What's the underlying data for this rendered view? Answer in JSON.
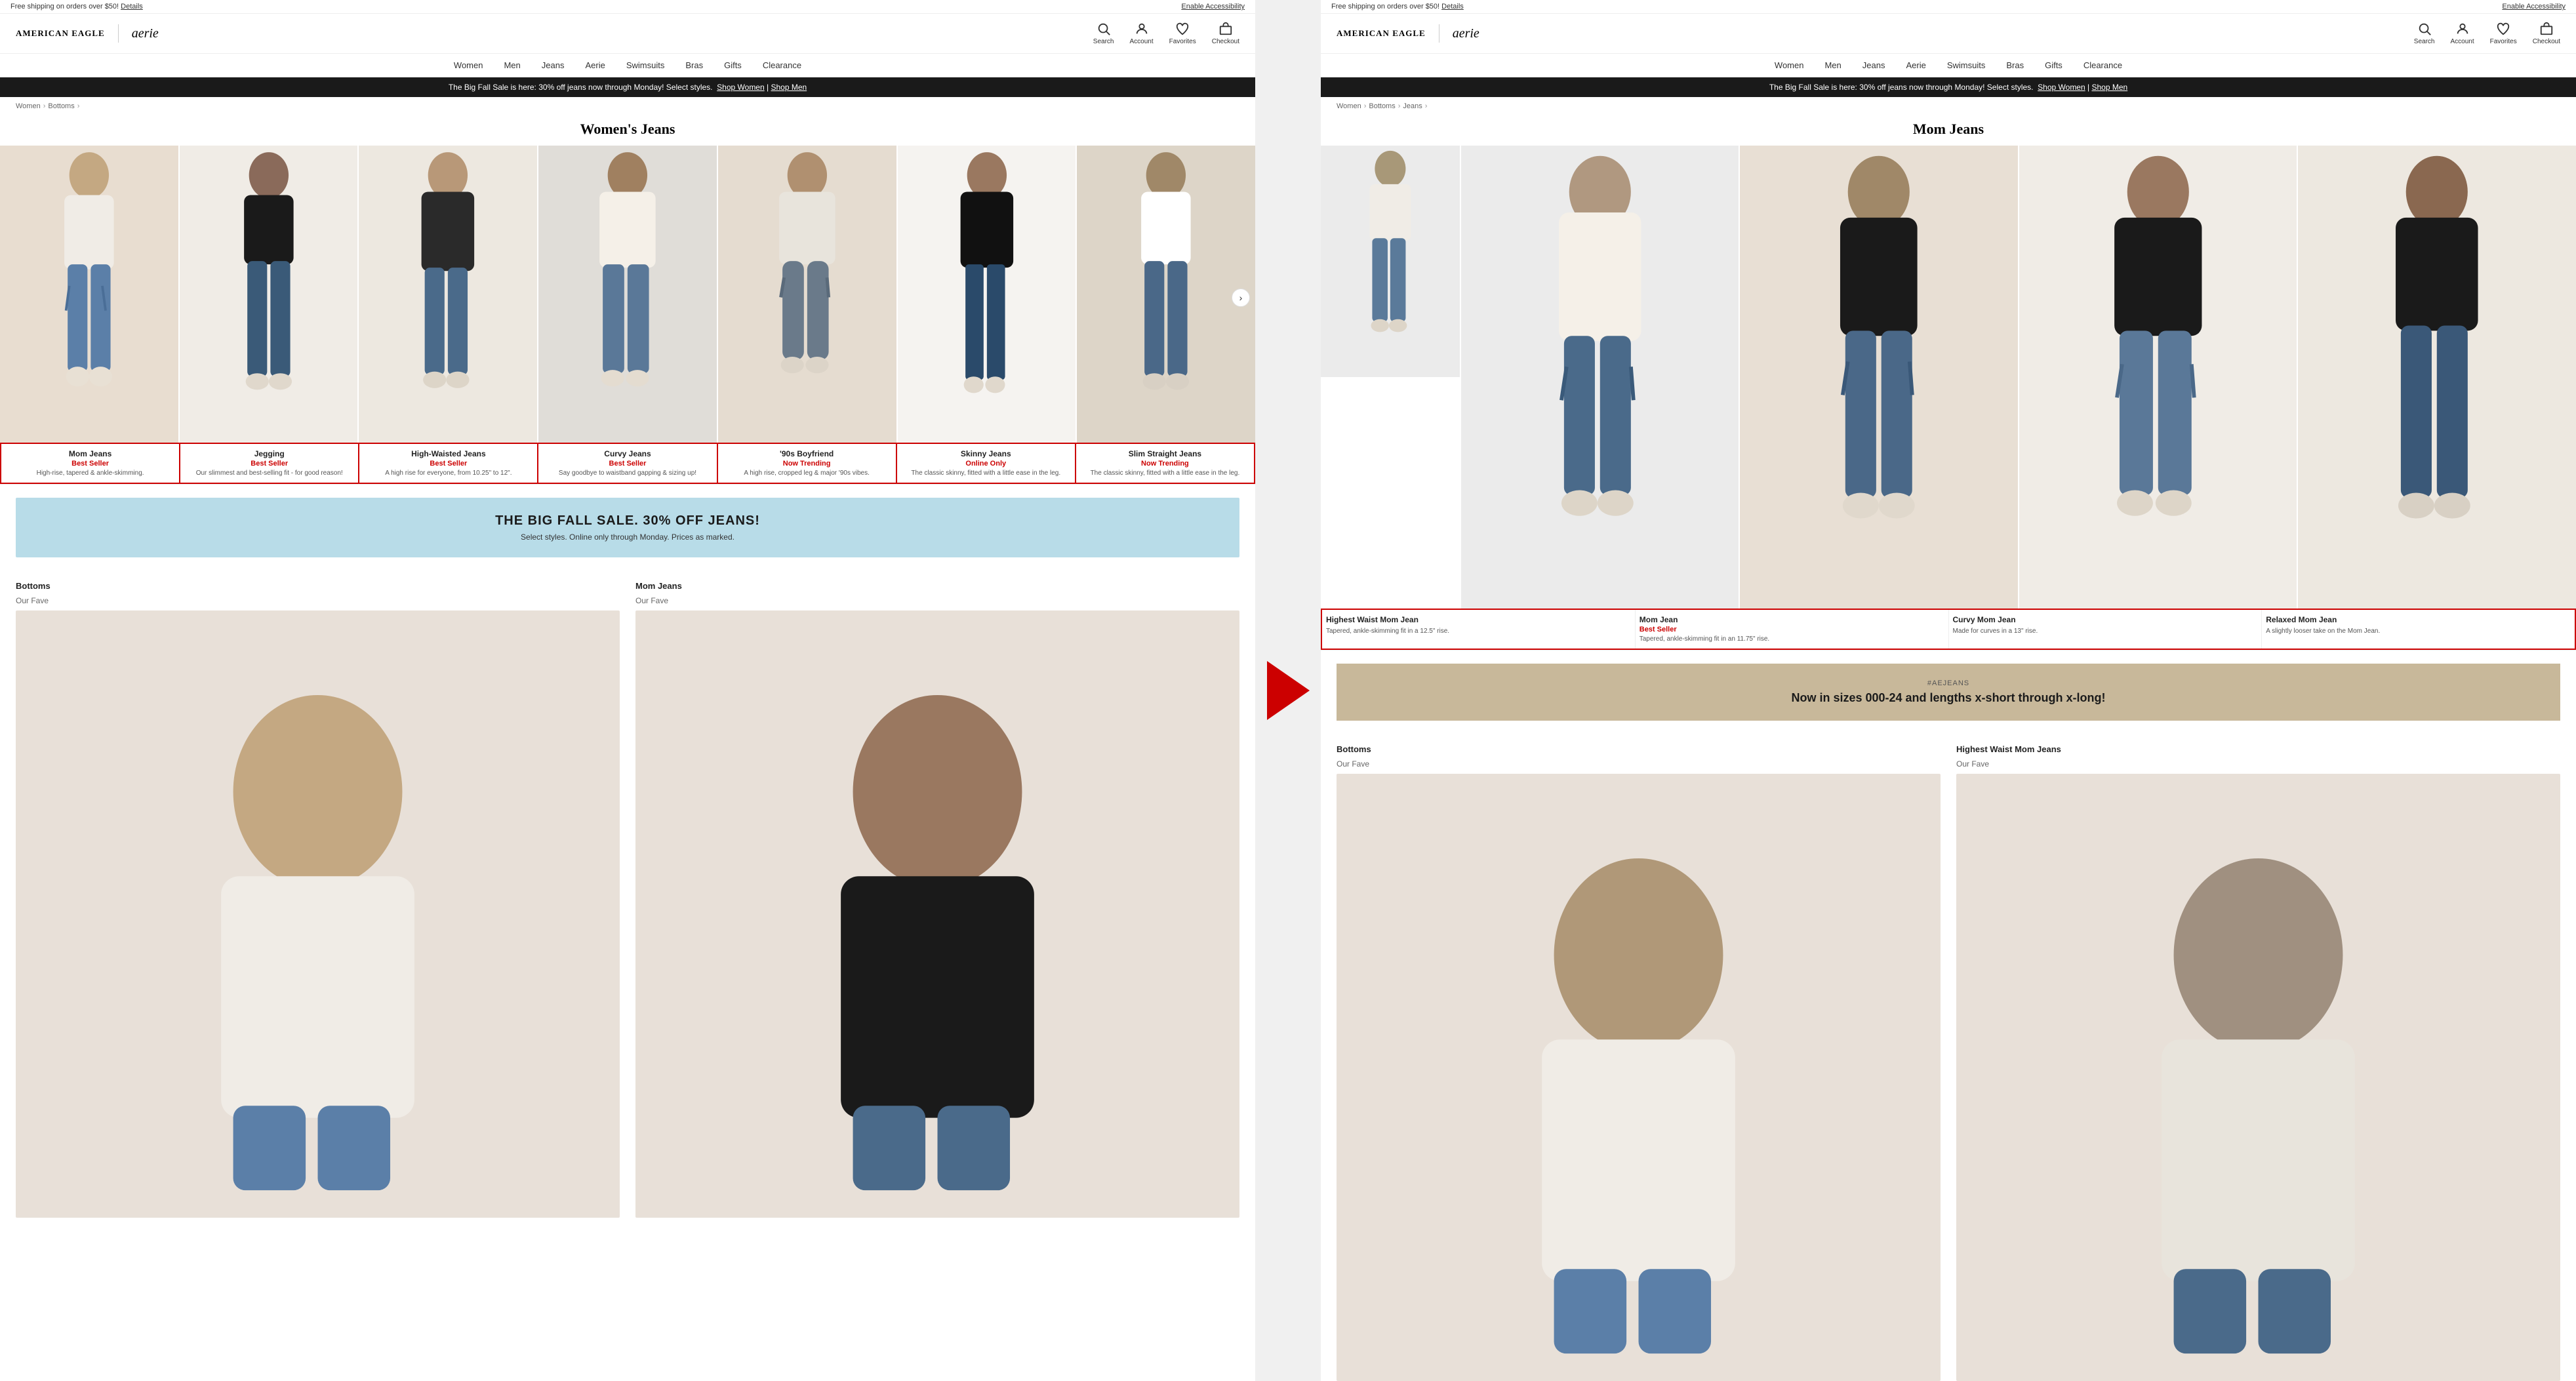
{
  "panels": [
    {
      "id": "left",
      "topbar": {
        "shipping_text": "Free shipping on orders over $50!",
        "details_link": "Details",
        "accessibility_link": "Enable Accessibility"
      },
      "header": {
        "logo_ae": "AMERICAN EAGLE",
        "logo_aerie": "aerie",
        "icons": [
          {
            "name": "search",
            "label": "Search",
            "symbol": "🔍"
          },
          {
            "name": "account",
            "label": "Account",
            "symbol": "👤"
          },
          {
            "name": "favorites",
            "label": "Favorites",
            "symbol": "♡"
          },
          {
            "name": "checkout",
            "label": "Checkout",
            "symbol": "🛍"
          }
        ]
      },
      "nav": {
        "items": [
          "Women",
          "Men",
          "Jeans",
          "Aerie",
          "Swimsuits",
          "Bras",
          "Gifts",
          "Clearance"
        ]
      },
      "promo_banner": {
        "text": "The Big Fall Sale is here: 30% off jeans now through Monday! Select styles.",
        "link1": "Shop Women",
        "link2": "Shop Men"
      },
      "breadcrumb": [
        "Women",
        "Bottoms"
      ],
      "page_title": "Women's Jeans",
      "products": [
        {
          "name": "Mom Jeans",
          "badge": "Best Seller",
          "desc": "High-rise, tapered & ankle-skimming.",
          "bg": "bg-warm"
        },
        {
          "name": "Jegging",
          "badge": "Best Seller",
          "desc": "Our slimmest and best-selling fit - for good reason!",
          "bg": "bg-light"
        },
        {
          "name": "High-Waisted Jeans",
          "badge": "Best Seller",
          "desc": "A high rise for everyone, from 10.25\" to 12\".",
          "bg": "bg-cream"
        },
        {
          "name": "Curvy Jeans",
          "badge": "Best Seller",
          "desc": "Say goodbye to waistband gapping & sizing up!",
          "bg": "bg-gray"
        },
        {
          "name": "'90s Boyfriend",
          "badge": "Now Trending",
          "desc": "A high rise, cropped leg & major '90s vibes.",
          "bg": "bg-nude"
        },
        {
          "name": "Skinny Jeans",
          "badge": "Online Only",
          "desc": "The classic skinny, fitted with a little ease in the leg.",
          "bg": "bg-white"
        },
        {
          "name": "Slim Straight Jeans",
          "badge": "Now Trending",
          "desc": "The classic skinny, fitted with a little ease in the leg.",
          "bg": "bg-tan"
        }
      ],
      "sale_banner": {
        "title": "THE BIG FALL SALE. 30% OFF JEANS!",
        "subtitle": "Select styles. Online only through Monday. Prices as marked."
      },
      "bottom": {
        "col1_title": "Bottoms",
        "col2_title": "Mom Jeans",
        "col1_subtitle": "Our Fave",
        "col2_subtitle": "Our Fave"
      }
    },
    {
      "id": "right",
      "topbar": {
        "shipping_text": "Free shipping on orders over $50!",
        "details_link": "Details",
        "accessibility_link": "Enable Accessibility"
      },
      "header": {
        "logo_ae": "AMERICAN EAGLE",
        "logo_aerie": "aerie",
        "icons": [
          {
            "name": "search",
            "label": "Search",
            "symbol": "🔍"
          },
          {
            "name": "account",
            "label": "Account",
            "symbol": "👤"
          },
          {
            "name": "favorites",
            "label": "Favorites",
            "symbol": "♡"
          },
          {
            "name": "checkout",
            "label": "Checkout",
            "symbol": "🛍"
          }
        ]
      },
      "nav": {
        "items": [
          "Women",
          "Men",
          "Jeans",
          "Aerie",
          "Swimsuits",
          "Bras",
          "Gifts",
          "Clearance"
        ]
      },
      "promo_banner": {
        "text": "The Big Fall Sale is here: 30% off jeans now through Monday! Select styles.",
        "link1": "Shop Women",
        "link2": "Shop Men"
      },
      "breadcrumb": [
        "Women",
        "Bottoms",
        "Jeans"
      ],
      "page_title": "Mom Jeans",
      "products": [
        {
          "name": "Highest Waist Mom Jean",
          "badge": "",
          "desc": "Tapered, ankle-skimming fit in a 12.5\" rise.",
          "bg": "bg-light-gray"
        },
        {
          "name": "Mom Jean",
          "badge": "Best Seller",
          "desc": "Tapered, ankle-skimming fit in an 11.75\" rise.",
          "bg": "bg-warm2"
        },
        {
          "name": "Curvy Mom Jean",
          "badge": "",
          "desc": "Made for curves in a 13\" rise.",
          "bg": "bg-light"
        },
        {
          "name": "Relaxed Mom Jean",
          "badge": "",
          "desc": "A slightly looser take on the Mom Jean.",
          "bg": "bg-cream"
        }
      ],
      "sale_banner": {
        "hashtag": "#AEJEANS",
        "title": "Now in sizes 000-24 and lengths x-short through x-long!"
      },
      "bottom": {
        "col1_title": "Bottoms",
        "col2_title": "Highest Waist Mom Jeans",
        "col1_subtitle": "Our Fave",
        "col2_subtitle": "Our Fave"
      }
    }
  ]
}
